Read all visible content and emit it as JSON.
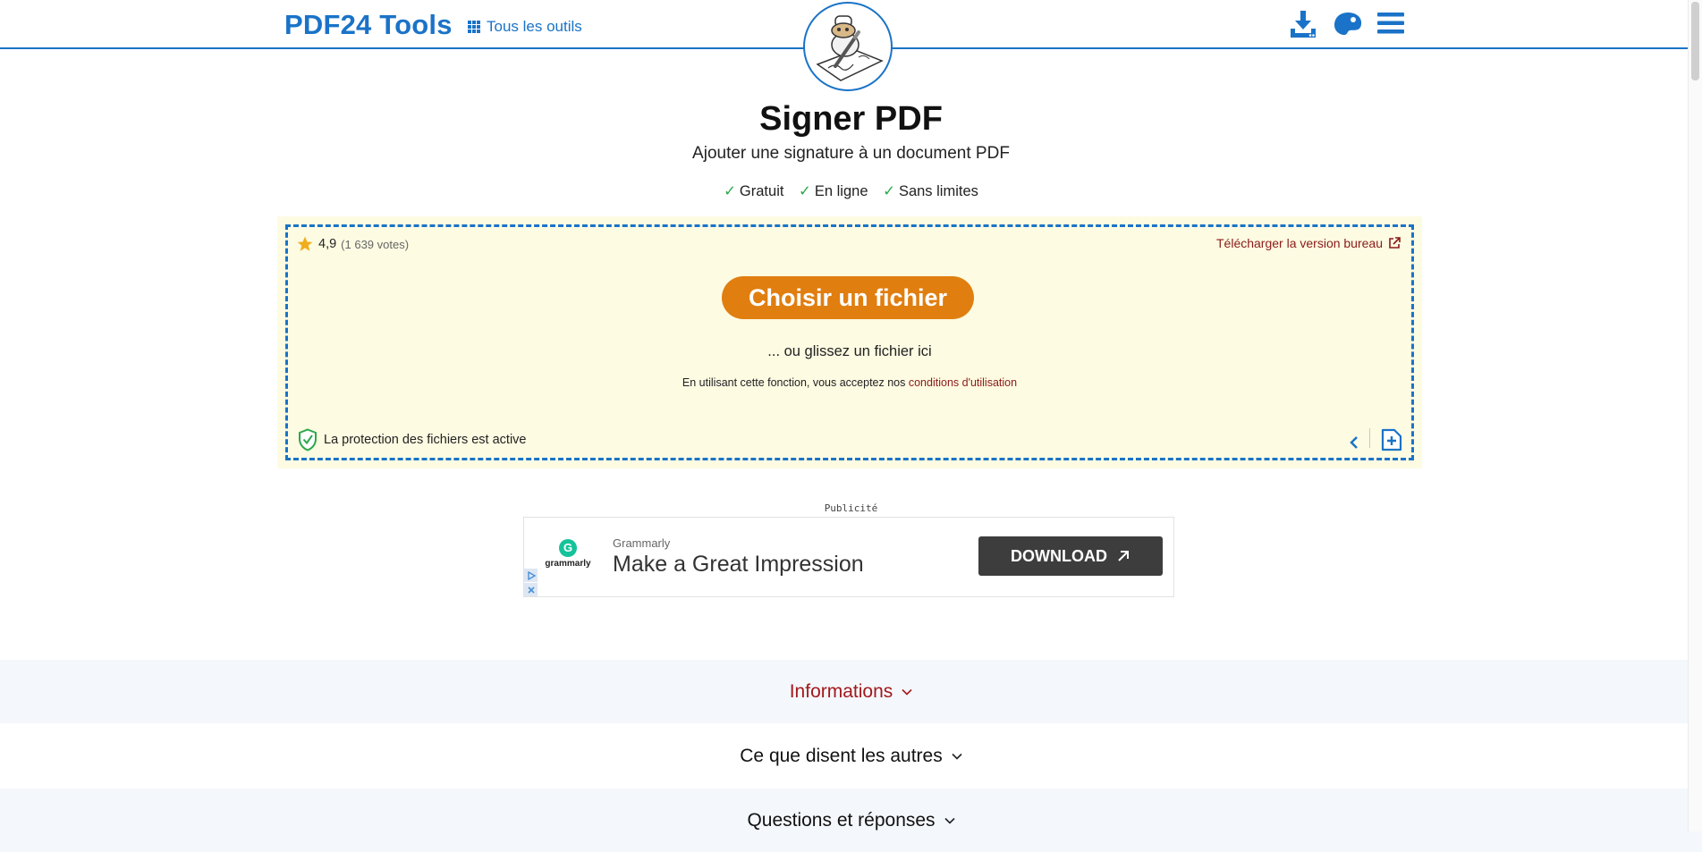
{
  "header": {
    "logo": "PDF24 Tools",
    "all_tools": "Tous les outils",
    "icons": [
      "grid-icon",
      "download-icon",
      "palette-icon",
      "menu-icon"
    ]
  },
  "tool": {
    "title": "Signer PDF",
    "subtitle": "Ajouter une signature à un document PDF",
    "features": [
      {
        "check": "✓",
        "label": "Gratuit"
      },
      {
        "check": "✓",
        "label": "En ligne"
      },
      {
        "check": "✓",
        "label": "Sans limites"
      }
    ]
  },
  "upload": {
    "rating": "4,9",
    "votes": "(1 639 votes)",
    "rating_value": 4.9,
    "desktop_link": "Télécharger la version bureau",
    "choose_button": "Choisir un fichier",
    "drop_text": "... ou glissez un fichier ici",
    "terms_prefix": "En utilisant cette fonction, vous acceptez nos",
    "terms_link": "conditions d'utilisation",
    "protection": "La protection des fichiers est active"
  },
  "ad": {
    "label": "Publicité",
    "logo_letter": "G",
    "logo_name": "grammarly",
    "brand": "Grammarly",
    "headline": "Make a Great Impression",
    "button": "DOWNLOAD"
  },
  "accordions": [
    {
      "label": "Informations",
      "color": "#a3191c"
    },
    {
      "label": "Ce que disent les autres",
      "color": "#111111"
    },
    {
      "label": "Questions et réponses",
      "color": "#111111"
    }
  ],
  "colors": {
    "brand_blue": "#1a73c8",
    "cta_orange": "#e07e10",
    "zone_bg": "#fdfbe2",
    "link_red": "#8b1a1a",
    "check_green": "#2aa84a"
  }
}
